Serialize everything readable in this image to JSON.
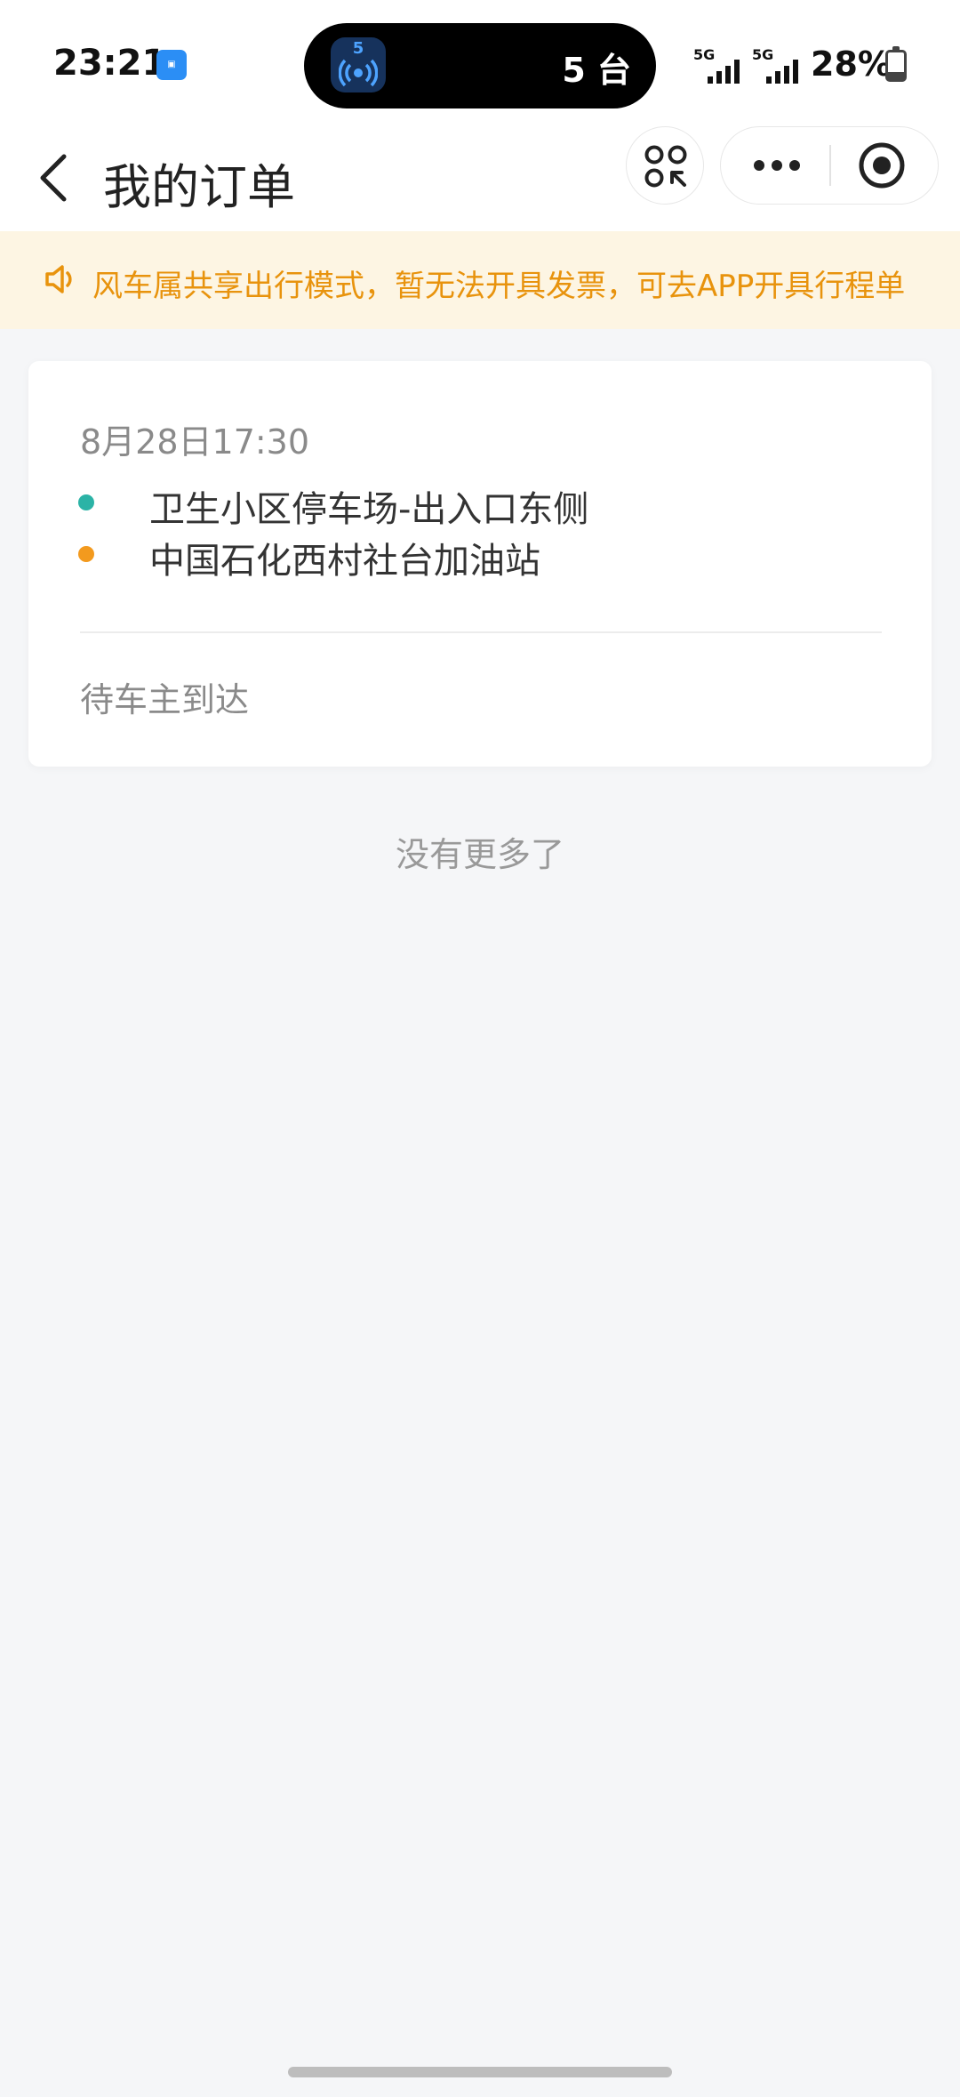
{
  "status_bar": {
    "time": "23:21",
    "dynamic_island": {
      "badge_number": "5",
      "text": "5 台"
    },
    "network_1": "5G",
    "network_2": "5G",
    "battery_percent": "28%",
    "battery_level": 0.28
  },
  "header": {
    "title": "我的订单"
  },
  "notice": {
    "text": "风车属共享出行模式，暂无法开具发票，可去APP开具行程单",
    "color": "#e8930d",
    "background": "#fdf5e3"
  },
  "orders": [
    {
      "date": "8月28日17:30",
      "start": "卫生小区停车场-出入口东侧",
      "end": "中国石化西村社台加油站",
      "start_color": "#2bb3a6",
      "end_color": "#f39a1e",
      "status": "待车主到达"
    }
  ],
  "list_end_text": "没有更多了"
}
